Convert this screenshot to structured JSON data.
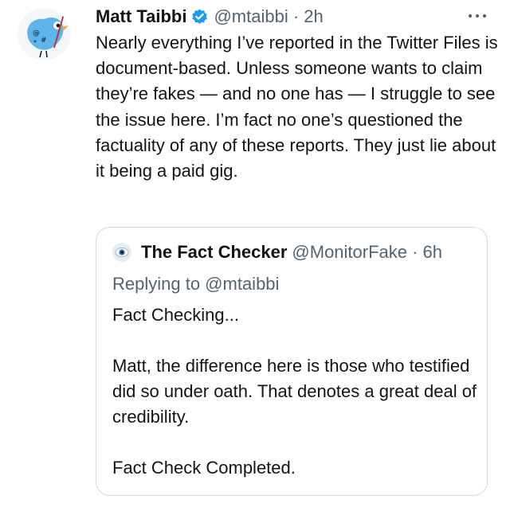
{
  "tweet": {
    "author_name": "Matt Taibbi",
    "handle_time": "@mtaibbi · 2h",
    "text": "Nearly everything I’ve reported in the Twitter Files is document-based. Unless someone wants to claim they’re fakes — and no one has — I struggle to see the issue here. I’m fact no one’s questioned the factuality of any of these reports. They just lie about it being a paid gig."
  },
  "quoted": {
    "author_name": "The Fact Checker",
    "handle_time": "@MonitorFake · 6h",
    "replying_to": "Replying to @mtaibbi",
    "text": "Fact Checking...\n\nMatt, the difference here is those who testified did so under oath. That denotes a great deal of credibility.\n\nFact Check Completed."
  },
  "colors": {
    "verified_blue": "#1d9bf0",
    "secondary_text": "#536471",
    "avatar_bird": "#5db5ec"
  },
  "icons": {
    "avatar": "blue-bird-doodle-icon",
    "verified": "verified-badge-icon",
    "more": "more-dots-icon",
    "quoted_avatar": "eye-icon"
  }
}
